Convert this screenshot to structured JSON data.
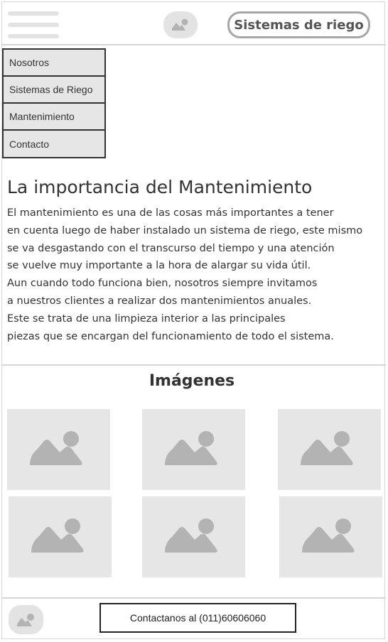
{
  "header": {
    "menu_icon": "hamburger-menu-icon",
    "logo_icon": "image-placeholder-icon",
    "cta_label": "Sistemas de riego"
  },
  "menu": {
    "items": [
      {
        "label": "Nosotros"
      },
      {
        "label": "Sistemas de Riego"
      },
      {
        "label": "Mantenimiento"
      },
      {
        "label": "Contacto"
      }
    ]
  },
  "article": {
    "title": "La importancia del Mantenimiento",
    "lines": [
      "El mantenimiento es una de las cosas más importantes a tener",
      "en cuenta luego de haber instalado un sistema de riego, este mismo",
      "se va desgastando con el transcurso del tiempo y una atención",
      "se vuelve muy importante a la hora de alargar su vida útil.",
      "Aun cuando todo funciona bien, nosotros siempre invitamos",
      "a nuestros clientes a realizar dos mantenimientos anuales.",
      "Este se trata de una limpieza interior a las principales",
      "piezas que se encargan del funcionamiento de todo el sistema."
    ]
  },
  "gallery": {
    "title": "Imágenes",
    "image_icon": "image-placeholder-icon"
  },
  "footer": {
    "logo_icon": "image-placeholder-icon",
    "contact_label": "Contactanos al (011)60606060"
  },
  "colors": {
    "placeholder_fill": "#e6e6e6",
    "placeholder_glyph": "#b3b3b3",
    "divider": "#d6d6d6",
    "text": "#333333"
  }
}
